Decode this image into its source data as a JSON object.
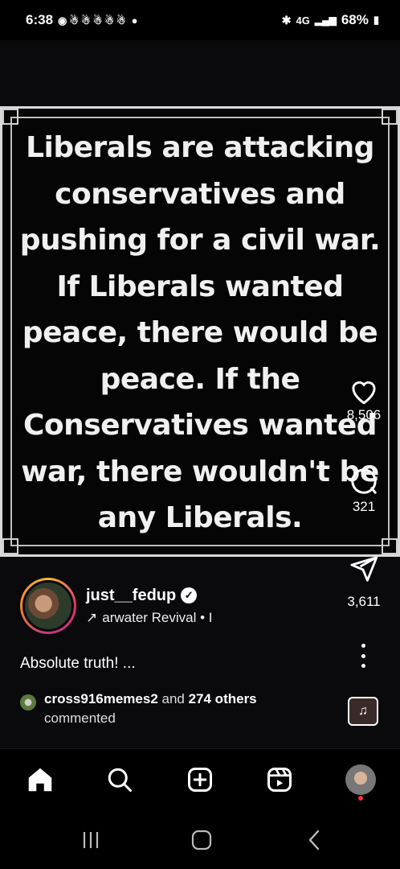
{
  "status_bar": {
    "time": "6:38",
    "network": "4G",
    "battery": "68%"
  },
  "post": {
    "image_text": "Liberals are attacking conservatives and pushing for a civil war. If Liberals wanted peace, there would be peace. If the Conservatives wanted war, there wouldn't be any Liberals.",
    "username": "just__fedup",
    "audio": "arwater Revival • I",
    "caption": "Absolute truth! ...",
    "comment_user": "cross916memes2",
    "comment_and": " and ",
    "comment_others": "274 others",
    "comment_suffix": "commented"
  },
  "actions": {
    "likes": "8,506",
    "comments": "321",
    "shares": "3,611"
  },
  "icons": {
    "like": "heart-icon",
    "comment": "comment-icon",
    "share": "send-icon",
    "more": "more-vertical-icon",
    "home": "home-icon",
    "search": "search-icon",
    "create": "plus-square-icon",
    "reels": "reels-icon"
  }
}
